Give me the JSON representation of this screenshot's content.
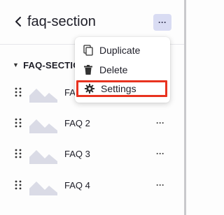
{
  "header": {
    "title": "faq-section",
    "more_label": "···"
  },
  "section": {
    "label": "FAQ-SECTION"
  },
  "menu": {
    "items": [
      {
        "label": "Duplicate",
        "icon": "duplicate-icon"
      },
      {
        "label": "Delete",
        "icon": "trash-icon"
      },
      {
        "label": "Settings",
        "icon": "gear-icon"
      }
    ]
  },
  "rows": [
    {
      "label": "FAQ 1",
      "more": "···"
    },
    {
      "label": "FAQ 2",
      "more": "···"
    },
    {
      "label": "FAQ 3",
      "more": "···"
    },
    {
      "label": "FAQ 4",
      "more": "···"
    }
  ],
  "colors": {
    "accent_bg": "#d9dcf3",
    "highlight_border": "#e8321f",
    "thumb": "#dadbe6"
  }
}
